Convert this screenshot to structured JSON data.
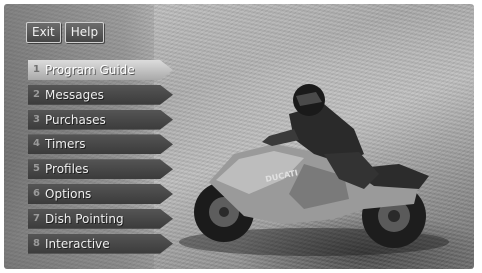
{
  "top_buttons": [
    {
      "label": "Exit"
    },
    {
      "label": "Help"
    }
  ],
  "menu": {
    "selected_index": 0,
    "items": [
      {
        "number": "1",
        "label": "Program Guide"
      },
      {
        "number": "2",
        "label": "Messages"
      },
      {
        "number": "3",
        "label": "Purchases"
      },
      {
        "number": "4",
        "label": "Timers"
      },
      {
        "number": "5",
        "label": "Profiles"
      },
      {
        "number": "6",
        "label": "Options"
      },
      {
        "number": "7",
        "label": "Dish Pointing"
      },
      {
        "number": "8",
        "label": "Interactive"
      }
    ]
  },
  "background": {
    "icon": "motorcycle-rider-image",
    "bike_text": "DUCATI"
  }
}
